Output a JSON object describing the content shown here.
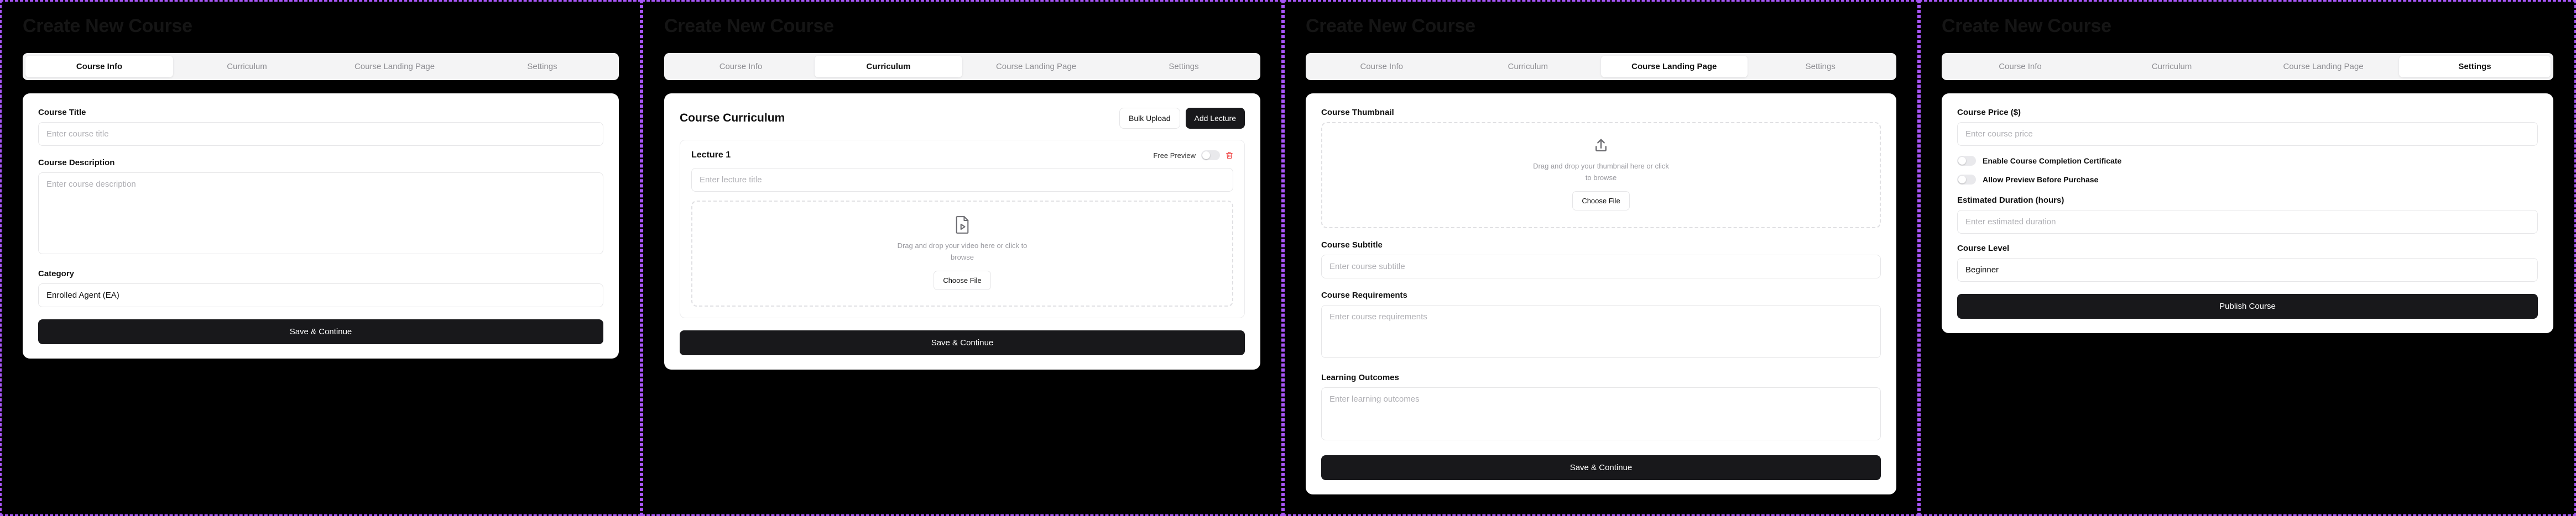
{
  "app": {
    "page_title": "Create New Course",
    "accent_border": "#a855f7",
    "dark_button": "#18181b",
    "tab_bar_bg": "#f4f4f5",
    "danger": "#ef4444"
  },
  "tabs": [
    {
      "label": "Course Info"
    },
    {
      "label": "Curriculum"
    },
    {
      "label": "Course Landing Page"
    },
    {
      "label": "Settings"
    }
  ],
  "panels": [
    {
      "active_tab": "Course Info",
      "fields": {
        "course_title_label": "Course Title",
        "course_title_placeholder": "Enter course title",
        "course_description_label": "Course Description",
        "course_description_placeholder": "Enter course description",
        "category_label": "Category",
        "category_value": "Enrolled Agent (EA)"
      },
      "submit_label": "Save & Continue"
    },
    {
      "active_tab": "Curriculum",
      "header": {
        "title": "Course Curriculum",
        "bulk_upload_label": "Bulk Upload",
        "add_lecture_label": "Add Lecture"
      },
      "lecture": {
        "name": "Lecture 1",
        "free_preview_label": "Free Preview",
        "free_preview_on": false,
        "delete_icon": "trash-icon",
        "title_placeholder": "Enter lecture title",
        "dropzone": {
          "icon": "video-file-icon",
          "text": "Drag and drop your video here or click to browse",
          "button_label": "Choose File"
        }
      },
      "submit_label": "Save & Continue"
    },
    {
      "active_tab": "Course Landing Page",
      "fields": {
        "thumbnail_label": "Course Thumbnail",
        "thumbnail_dropzone": {
          "icon": "upload-icon",
          "text": "Drag and drop your thumbnail here or click to browse",
          "button_label": "Choose File"
        },
        "subtitle_label": "Course Subtitle",
        "subtitle_placeholder": "Enter course subtitle",
        "requirements_label": "Course Requirements",
        "requirements_placeholder": "Enter course requirements",
        "outcomes_label": "Learning Outcomes",
        "outcomes_placeholder": "Enter learning outcomes"
      },
      "submit_label": "Save & Continue"
    },
    {
      "active_tab": "Settings",
      "fields": {
        "price_label": "Course Price ($)",
        "price_placeholder": "Enter course price",
        "certificate_toggle_label": "Enable Course Completion Certificate",
        "certificate_toggle_on": false,
        "preview_toggle_label": "Allow Preview Before Purchase",
        "preview_toggle_on": false,
        "duration_label": "Estimated Duration (hours)",
        "duration_placeholder": "Enter estimated duration",
        "level_label": "Course Level",
        "level_value": "Beginner"
      },
      "submit_label": "Publish Course"
    }
  ]
}
